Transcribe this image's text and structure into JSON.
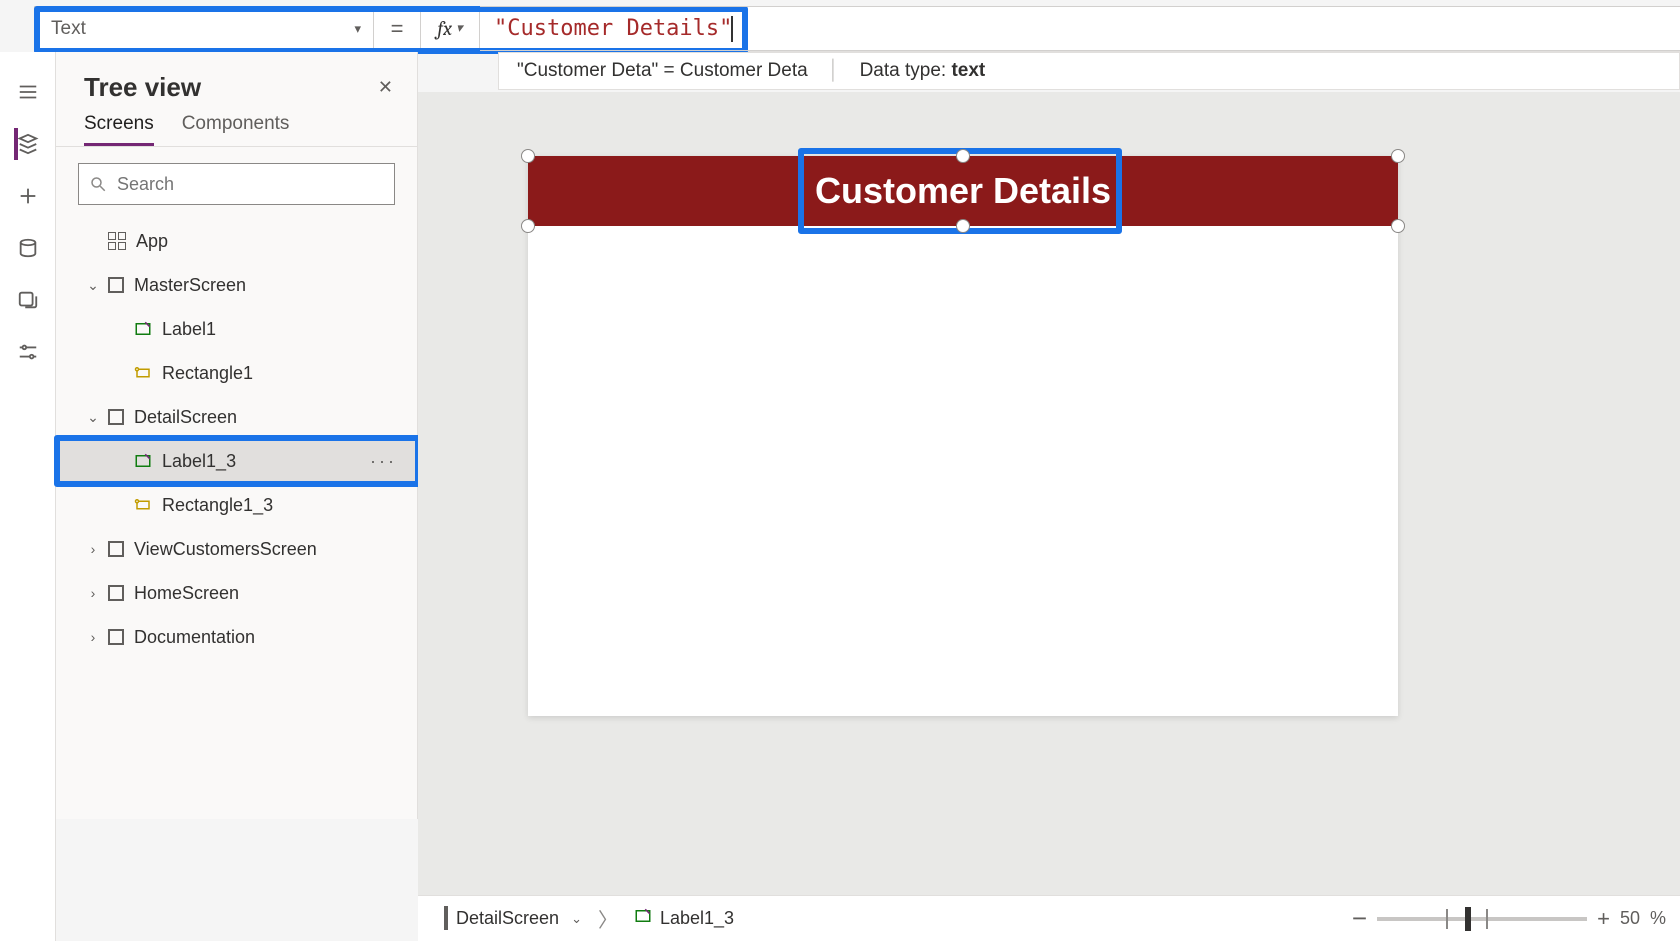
{
  "formulaBar": {
    "property": "Text",
    "equals": "=",
    "fx": "fx",
    "value": "\"Customer Details\""
  },
  "intelli": {
    "left": "\"Customer Deta\"  =  Customer Deta",
    "dataTypeLabel": "Data type: ",
    "dataType": "text"
  },
  "treePanel": {
    "title": "Tree view",
    "tabs": {
      "screens": "Screens",
      "components": "Components"
    },
    "searchPlaceholder": "Search",
    "appLabel": "App"
  },
  "tree": {
    "master": {
      "label": "MasterScreen"
    },
    "label1": {
      "label": "Label1"
    },
    "rect1": {
      "label": "Rectangle1"
    },
    "detail": {
      "label": "DetailScreen"
    },
    "label13": {
      "label": "Label1_3"
    },
    "rect13": {
      "label": "Rectangle1_3"
    },
    "viewCust": {
      "label": "ViewCustomersScreen"
    },
    "home": {
      "label": "HomeScreen"
    },
    "docs": {
      "label": "Documentation"
    }
  },
  "canvas": {
    "bannerText": "Customer Details"
  },
  "breadcrumb": {
    "screen": "DetailScreen",
    "control": "Label1_3"
  },
  "zoom": {
    "minus": "−",
    "plus": "+",
    "value": "50",
    "pct": "%"
  }
}
